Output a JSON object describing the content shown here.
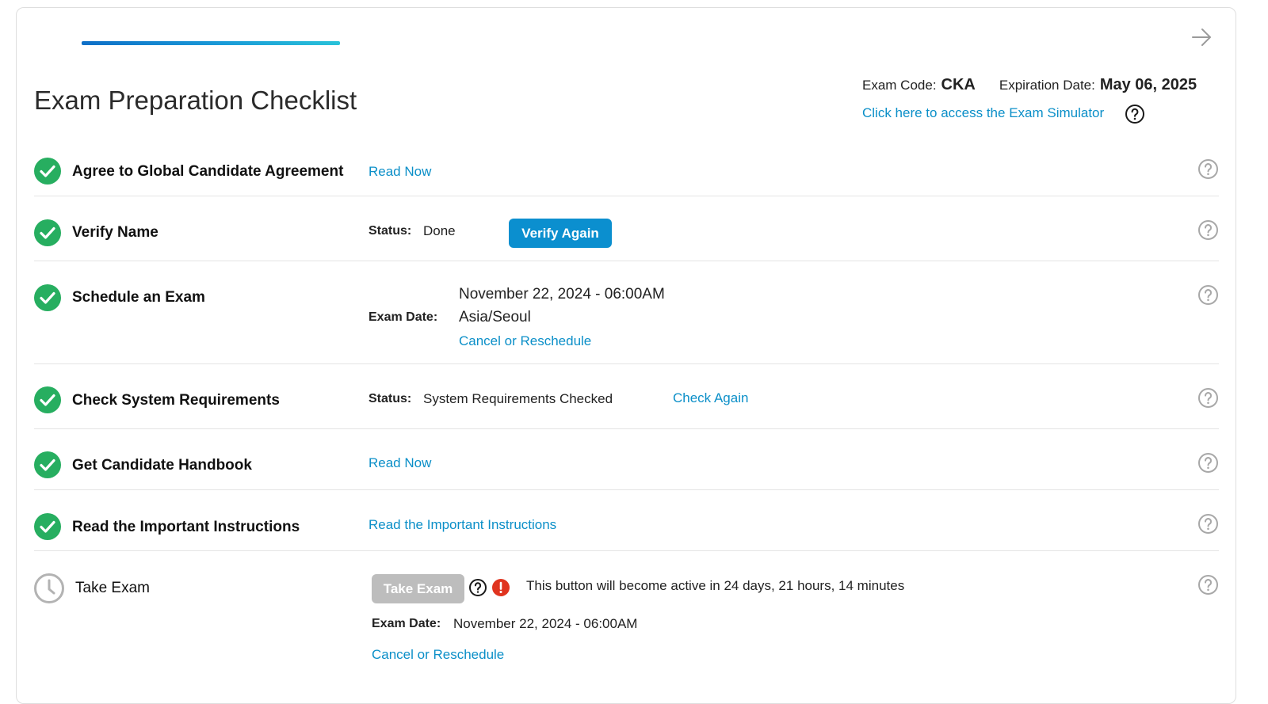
{
  "progress": {
    "fraction": 0.46
  },
  "header": {
    "title": "Exam Preparation Checklist",
    "exam_code_label": "Exam Code:",
    "exam_code": "CKA",
    "expiration_label": "Expiration Date:",
    "expiration_date": "May 06, 2025",
    "simulator_link": "Click here to access the Exam Simulator"
  },
  "items": [
    {
      "title": "Agree to Global Candidate Agreement",
      "link": "Read Now"
    },
    {
      "title": "Verify Name",
      "status_label": "Status:",
      "status": "Done",
      "button": "Verify Again"
    },
    {
      "title": "Schedule an Exam",
      "date_label": "Exam Date:",
      "date": "November 22, 2024 - 06:00AM",
      "timezone": "Asia/Seoul",
      "link": "Cancel or Reschedule"
    },
    {
      "title": "Check System Requirements",
      "status_label": "Status:",
      "status": "System Requirements Checked",
      "link": "Check Again"
    },
    {
      "title": "Get Candidate Handbook",
      "link": "Read Now"
    },
    {
      "title": "Read the Important Instructions",
      "link": "Read the Important Instructions"
    },
    {
      "title": "Take Exam",
      "button": "Take Exam",
      "notice": "This button will become active in 24 days, 21 hours, 14 minutes",
      "date_label": "Exam Date:",
      "date": "November 22, 2024 - 06:00AM",
      "link": "Cancel or Reschedule"
    }
  ],
  "icons": {
    "complete": "check-circle-icon",
    "pending": "clock-icon",
    "help": "question-circle-icon",
    "alert": "exclamation-circle-icon",
    "next": "arrow-right-icon"
  },
  "colors": {
    "accent": "#0b8fc8",
    "success": "#27ae60",
    "alert": "#e0341f",
    "disabled": "#bdbdbd"
  }
}
